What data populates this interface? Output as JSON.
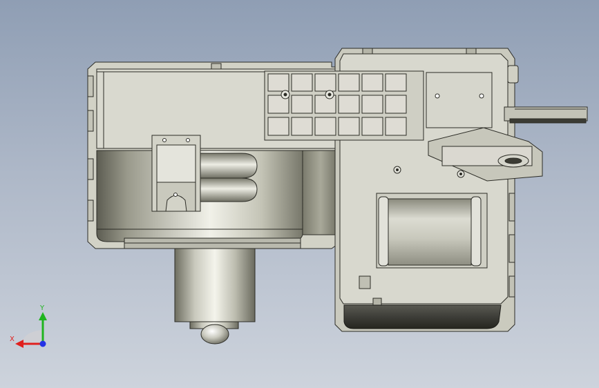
{
  "viewport": {
    "background_top": "#8f9eb4",
    "background_bottom": "#cdd3dc"
  },
  "triad": {
    "x_label": "X",
    "y_label": "Y",
    "x_color": "#e0201e",
    "y_color": "#1fb41f",
    "z_color": "#2432e6"
  }
}
